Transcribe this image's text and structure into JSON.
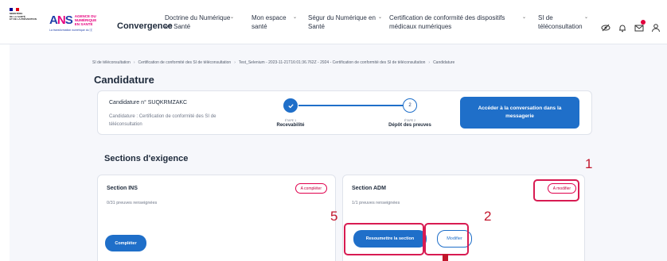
{
  "header": {
    "logo_rf_lines": [
      "MINISTÈRE",
      "DE LA SANTÉ",
      "ET DE LA PRÉVENTION"
    ],
    "logo_ans_mark": "ANS",
    "logo_ans_text": "AGENCE DU NUMÉRIQUE EN SANTÉ",
    "logo_ans_sub": "La transformation numérique du 🅂",
    "app_title": "Convergence",
    "nav": [
      {
        "label": "Doctrine du Numérique en Santé"
      },
      {
        "label": "Mon espace santé"
      },
      {
        "label": "Ségur du Numérique en Santé"
      },
      {
        "label": "Certification de conformité des dispositifs médicaux numériques"
      },
      {
        "label": "SI de téléconsultation"
      }
    ],
    "icons": [
      "eye-off-icon",
      "bell-icon",
      "mail-icon",
      "user-icon"
    ]
  },
  "breadcrumb": {
    "items": [
      "SI de téléconsultation",
      "Certification de conformité des SI de téléconsultation",
      "Test_Selenium - 2023-11-21T16:01:36.762Z - 2924 - Certification de conformité des SI de téléconsultation",
      "Candidature"
    ]
  },
  "page": {
    "title": "Candidature"
  },
  "candidature": {
    "number": "Candidature n° SUQKRMZAKC",
    "description": "Candidature : Certification de conformité des SI de téléconsultation",
    "step1": {
      "small": "ÉTAPE 1",
      "label": "Recevabilité",
      "icon": "check-icon"
    },
    "step2": {
      "number": "2",
      "small": "ÉTAPE 2",
      "label": "Dépôt des preuves"
    },
    "conversation_button": "Accéder à la conversation dans la messagerie"
  },
  "sections": {
    "title": "Sections d'exigence",
    "ins": {
      "name": "Section INS",
      "badge": "A compléter",
      "proofs": "0/31 preuves renseignées",
      "button": "Compléter"
    },
    "adm": {
      "name": "Section ADM",
      "badge": "A modifier",
      "proofs": "1/1 preuves renseignées",
      "resubmit_button": "Resoumettre la section",
      "modify_button": "Modifier"
    }
  },
  "annotations": {
    "n1": "1",
    "n2": "2",
    "n5": "5"
  },
  "colors": {
    "primary": "#1f6fc9",
    "annotation": "#d81b52",
    "badge": "#e0004d",
    "background": "#f6f7fb"
  }
}
